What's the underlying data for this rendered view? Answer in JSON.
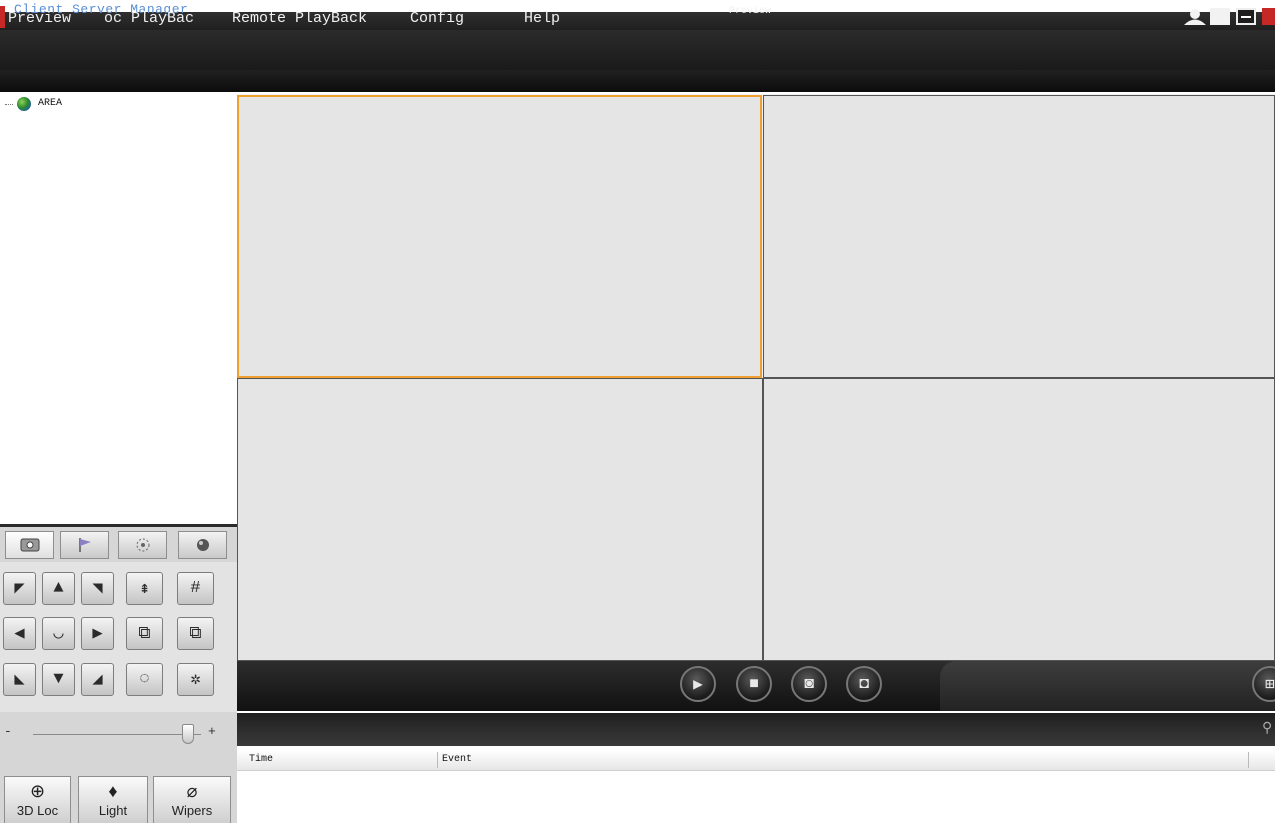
{
  "window": {
    "title": "Client Server Manager"
  },
  "menu": {
    "items": [
      "Preview",
      "oc PlayBac",
      "Remote PlayBack",
      "Config",
      "Help"
    ]
  },
  "preview_header": {
    "label": "Preview"
  },
  "tree": {
    "root_label": "AREA"
  },
  "ptz": {
    "tabs": [
      "ptz-icon",
      "preset-flag-icon",
      "cruise-icon",
      "track-icon"
    ],
    "slider": {
      "minus": "-",
      "plus": "+",
      "value_fraction": 0.92
    },
    "buttons": [
      {
        "label": "3D Loc",
        "icon": "zoom-in-icon"
      },
      {
        "label": "Light",
        "icon": "bulb-icon"
      },
      {
        "label": "Wipers",
        "icon": "wiper-icon"
      }
    ]
  },
  "log_table": {
    "columns": [
      "Time",
      "Event"
    ]
  },
  "colors": {
    "selected_cell_border": "#f0a030",
    "title_text": "#5b8fd6"
  }
}
